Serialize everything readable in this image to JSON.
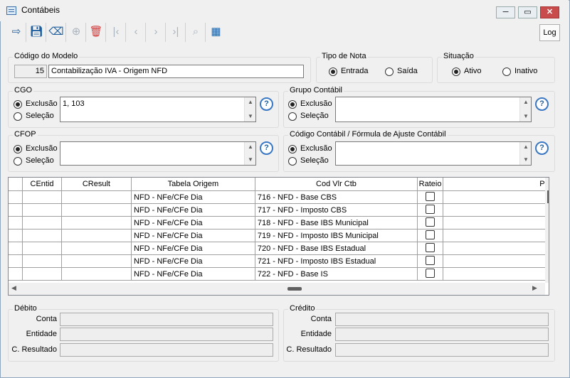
{
  "window": {
    "title": "Contábeis",
    "min": "─",
    "max": "▭",
    "close": "✕"
  },
  "toolbar": {
    "log_label": "Log"
  },
  "modelo": {
    "group_label": "Código do Modelo",
    "code": "15",
    "name": "Contabilização IVA - Origem NFD"
  },
  "tipo_nota": {
    "group_label": "Tipo de Nota",
    "opt1": "Entrada",
    "opt2": "Saída",
    "selected": "Entrada"
  },
  "situacao": {
    "group_label": "Situação",
    "opt1": "Ativo",
    "opt2": "Inativo",
    "selected": "Ativo"
  },
  "cgo": {
    "group_label": "CGO",
    "opt1": "Exclusão",
    "opt2": "Seleção",
    "value": "1, 103"
  },
  "grupo_contabil": {
    "group_label": "Grupo Contábil",
    "opt1": "Exclusão",
    "opt2": "Seleção",
    "value": ""
  },
  "cfop": {
    "group_label": "CFOP",
    "opt1": "Exclusão",
    "opt2": "Seleção",
    "value": ""
  },
  "codigo_contabil": {
    "group_label": "Código Contábil / Fórmula de Ajuste Contábil",
    "opt1": "Exclusão",
    "opt2": "Seleção",
    "value": ""
  },
  "grid": {
    "columns": [
      "CEntid",
      "CResult",
      "Tabela Origem",
      "Cod Vlr Ctb",
      "Rateio",
      "Pl"
    ],
    "rows": [
      {
        "centid": "",
        "cresult": "",
        "tabela": "NFD - NFe/CFe Dia",
        "cod": "716 - NFD - Base CBS",
        "rateio": false
      },
      {
        "centid": "",
        "cresult": "",
        "tabela": "NFD - NFe/CFe Dia",
        "cod": "717 - NFD - Imposto CBS",
        "rateio": false
      },
      {
        "centid": "",
        "cresult": "",
        "tabela": "NFD - NFe/CFe Dia",
        "cod": "718 - NFD - Base IBS Municipal",
        "rateio": false
      },
      {
        "centid": "",
        "cresult": "",
        "tabela": "NFD - NFe/CFe Dia",
        "cod": "719 - NFD - Imposto IBS Municipal",
        "rateio": false
      },
      {
        "centid": "",
        "cresult": "",
        "tabela": "NFD - NFe/CFe Dia",
        "cod": "720 - NFD - Base IBS Estadual",
        "rateio": false
      },
      {
        "centid": "",
        "cresult": "",
        "tabela": "NFD - NFe/CFe Dia",
        "cod": "721 - NFD - Imposto IBS Estadual",
        "rateio": false
      },
      {
        "centid": "",
        "cresult": "",
        "tabela": "NFD - NFe/CFe Dia",
        "cod": "722 - NFD - Base IS",
        "rateio": false
      }
    ]
  },
  "debito": {
    "group_label": "Débito",
    "conta": "Conta",
    "entidade": "Entidade",
    "resultado": "C. Resultado"
  },
  "credito": {
    "group_label": "Crédito",
    "conta": "Conta",
    "entidade": "Entidade",
    "resultado": "C. Resultado"
  }
}
